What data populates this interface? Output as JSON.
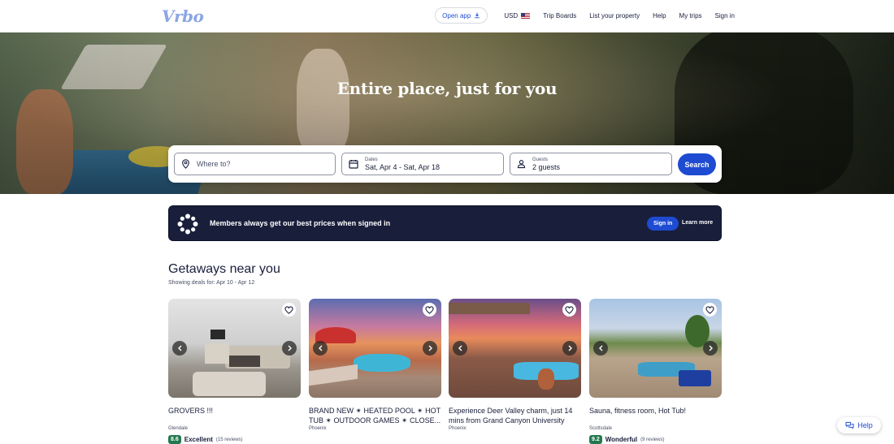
{
  "header": {
    "logo": "Vrbo",
    "open_app": "Open app",
    "currency": "USD",
    "nav": [
      "Trip Boards",
      "List your property",
      "Help",
      "My trips",
      "Sign in"
    ]
  },
  "hero": {
    "title": "Entire place, just for you",
    "destination_placeholder": "Where to?",
    "dates_label": "Dates",
    "dates_value": "Sat, Apr 4 - Sat, Apr 18",
    "guests_label": "Guests",
    "guests_value": "2 guests",
    "search_label": "Search"
  },
  "banner": {
    "text": "Members always get our best prices when signed in",
    "sign_in": "Sign in",
    "learn_more": "Learn more"
  },
  "getaways": {
    "title": "Getaways near you",
    "subtitle": "Showing deals for: Apr 10 - Apr 12",
    "cards": [
      {
        "title": "GROVERS !!!",
        "location": "Glendale",
        "score": "8.6",
        "rating": "Excellent",
        "reviews": "(15 reviews)"
      },
      {
        "title": "BRAND NEW ✴ HEATED POOL ✴ HOT TUB ✴ OUTDOOR GAMES ✴ CLOSE...",
        "location": "Phoenix",
        "score": "",
        "rating": "",
        "reviews": ""
      },
      {
        "title": "Experience Deer Valley charm, just 14 mins from Grand Canyon University",
        "location": "Phoenix",
        "score": "",
        "rating": "",
        "reviews": ""
      },
      {
        "title": "Sauna, fitness room, Hot Tub!",
        "location": "Scottsdale",
        "score": "9.2",
        "rating": "Wonderful",
        "reviews": "(9 reviews)"
      }
    ]
  },
  "help_label": "Help",
  "colors": {
    "brand_blue": "#1e4bd2",
    "banner_navy": "#191e3b",
    "score_green": "#227950"
  }
}
